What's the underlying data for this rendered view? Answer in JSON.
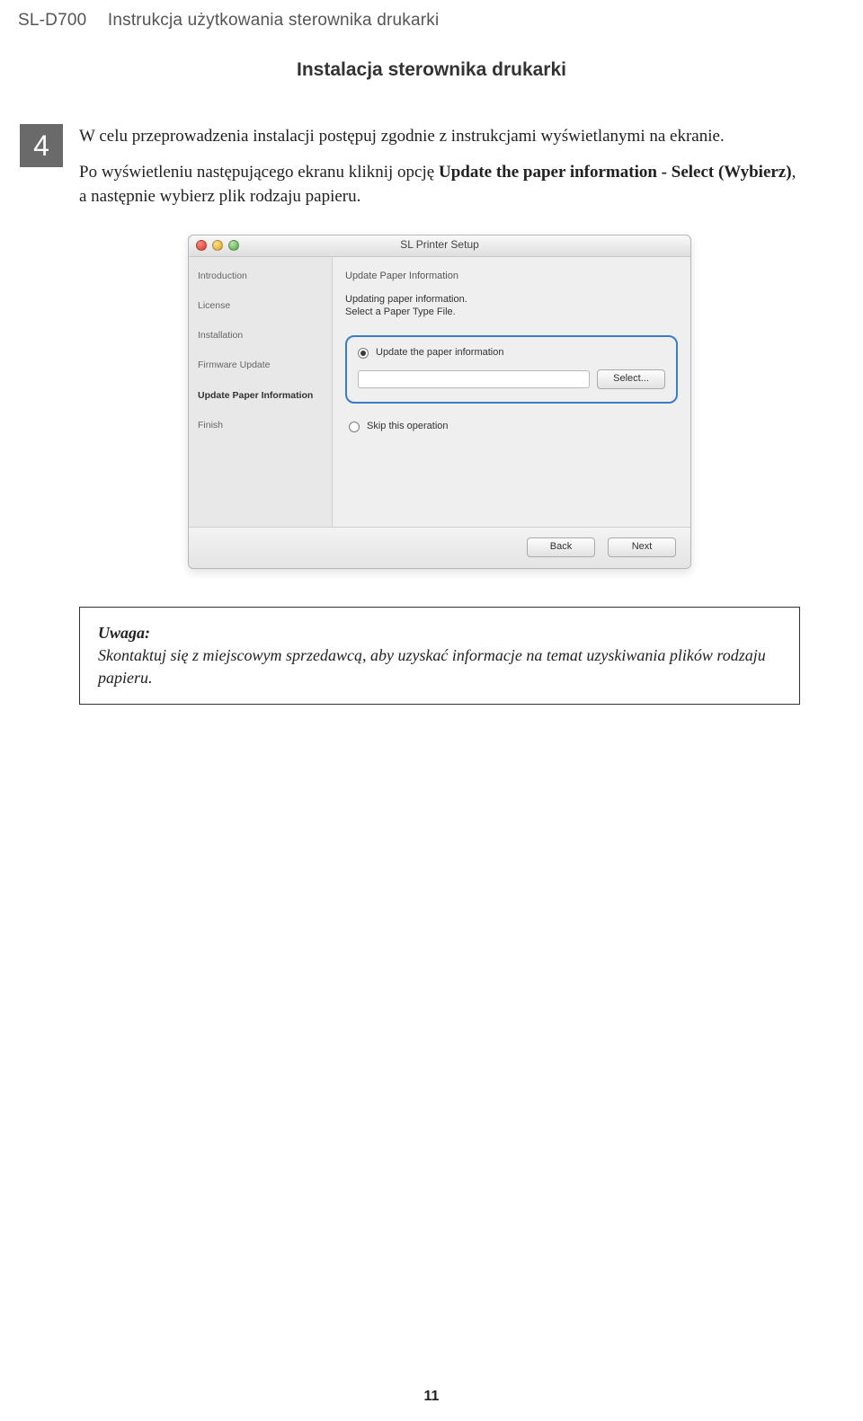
{
  "header": {
    "model": "SL-D700",
    "doc_title": "Instrukcja użytkowania sterownika drukarki"
  },
  "section_title": "Instalacja sterownika drukarki",
  "step": {
    "number": "4",
    "para1": "W celu przeprowadzenia instalacji postępuj zgodnie z instrukcjami wyświetlanymi na ekranie.",
    "para2_pre": "Po wyświetleniu następującego ekranu kliknij opcję ",
    "para2_bold": "Update the paper information - Select (Wybierz)",
    "para2_post": ", a następnie wybierz plik rodzaju papieru."
  },
  "dialog": {
    "title": "SL Printer Setup",
    "sidebar": {
      "items": [
        "Introduction",
        "License",
        "Installation",
        "Firmware Update",
        "Update Paper Information",
        "Finish"
      ]
    },
    "pane": {
      "header": "Update Paper Information",
      "line1": "Updating paper information.",
      "line2": "Select a Paper Type File.",
      "opt_update": "Update the paper information",
      "select_btn": "Select...",
      "opt_skip": "Skip this operation"
    },
    "buttons": {
      "back": "Back",
      "next": "Next"
    }
  },
  "note": {
    "title": "Uwaga:",
    "text": "Skontaktuj się z miejscowym sprzedawcą, aby uzyskać informacje na temat uzyskiwania plików rodzaju papieru."
  },
  "page_number": "11"
}
